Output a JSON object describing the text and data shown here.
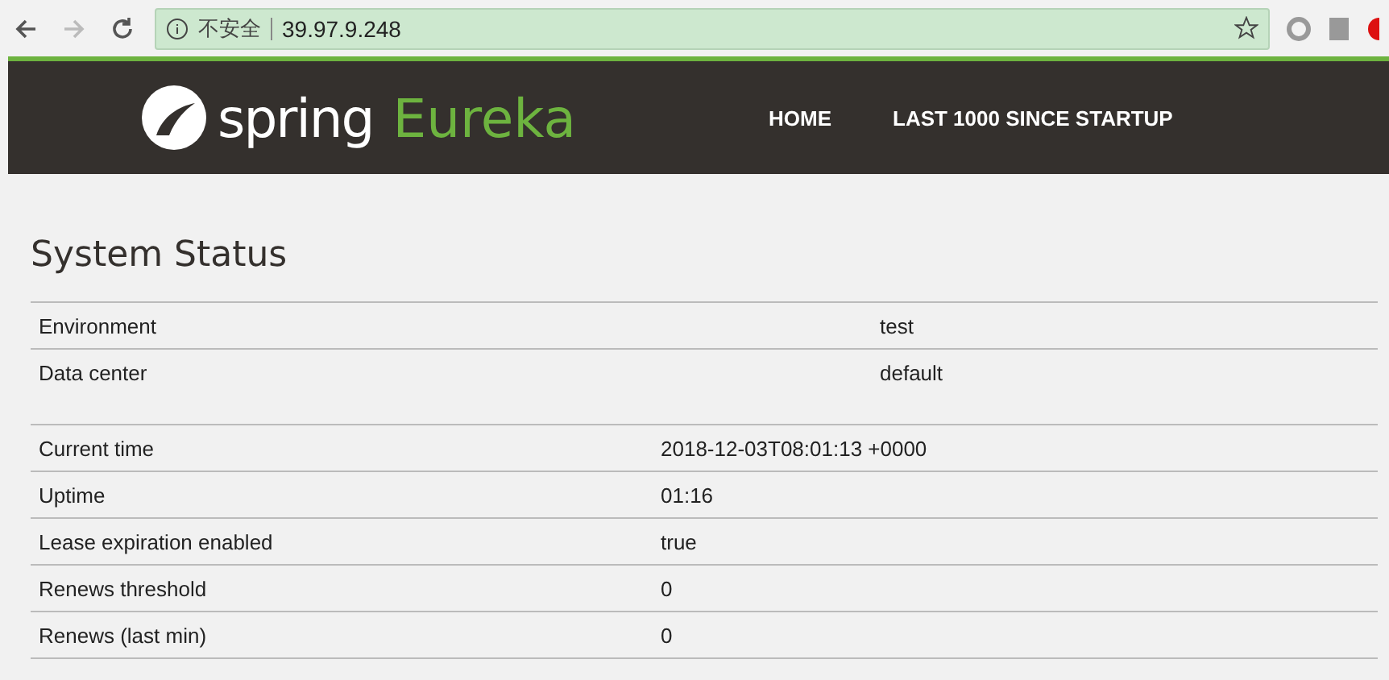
{
  "browser": {
    "security_label": "不安全",
    "url": "39.97.9.248"
  },
  "navbar": {
    "brand_word": "spring",
    "brand_product": "Eureka",
    "links": [
      "HOME",
      "LAST 1000 SINCE STARTUP"
    ]
  },
  "section_title": "System Status",
  "environment_table": [
    {
      "label": "Environment",
      "value": "test"
    },
    {
      "label": "Data center",
      "value": "default"
    }
  ],
  "status_table": [
    {
      "label": "Current time",
      "value": "2018-12-03T08:01:13 +0000"
    },
    {
      "label": "Uptime",
      "value": "01:16"
    },
    {
      "label": "Lease expiration enabled",
      "value": "true"
    },
    {
      "label": "Renews threshold",
      "value": "0"
    },
    {
      "label": "Renews (last min)",
      "value": "0"
    }
  ]
}
